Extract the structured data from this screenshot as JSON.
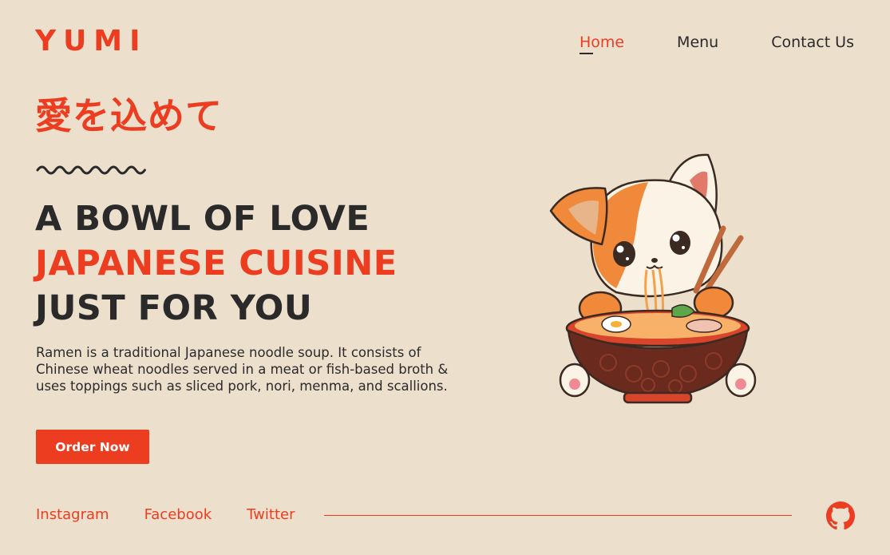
{
  "brand": {
    "logo": "YUMI",
    "accent_color": "#ec3d21",
    "background_color": "#ece0cd",
    "text_color": "#2a2a2a"
  },
  "nav": {
    "items": [
      {
        "label": "Home",
        "active": true
      },
      {
        "label": "Menu",
        "active": false
      },
      {
        "label": "Contact Us",
        "active": false
      }
    ]
  },
  "hero": {
    "jp_title": "愛を込めて",
    "headline": {
      "line1": "A BOWL OF LOVE",
      "line2": "JAPANESE CUISINE",
      "line3": "JUST FOR YOU"
    },
    "description": "Ramen is a traditional Japanese noodle soup. It consists of Chinese wheat noodles served in a meat or fish-based broth & uses toppings such as sliced pork, nori, menma, and scallions.",
    "cta_label": "Order Now",
    "illustration": "cat-eating-ramen-illustration"
  },
  "footer": {
    "socials": [
      {
        "label": "Instagram"
      },
      {
        "label": "Facebook"
      },
      {
        "label": "Twitter"
      }
    ],
    "github_icon": "github-icon"
  }
}
